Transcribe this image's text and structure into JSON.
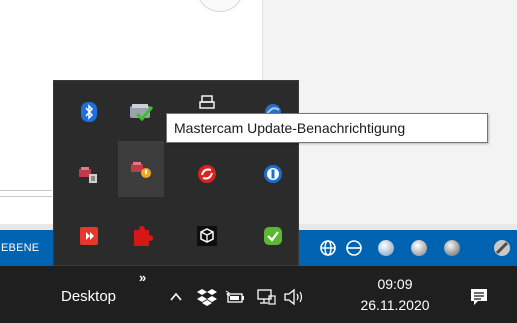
{
  "toolbar": {
    "label": "EBENE"
  },
  "taskbar": {
    "desktop_label": "Desktop",
    "overflow_chevron": "»",
    "clock": {
      "time": "09:09",
      "date": "26.11.2020"
    }
  },
  "tray_flyout": {
    "tooltip": "Mastercam Update-Benachrichtigung",
    "icons": [
      {
        "name": "bluetooth-icon"
      },
      {
        "name": "mastercam-check-icon"
      },
      {
        "name": "printer-icon"
      },
      {
        "name": "network-sync-icon"
      },
      {
        "name": "mastercam-license-icon"
      },
      {
        "name": "mastercam-update-icon"
      },
      {
        "name": "sync-circle-icon"
      },
      {
        "name": "password-manager-icon"
      },
      {
        "name": "anydesk-icon"
      },
      {
        "name": "puzzle-icon"
      },
      {
        "name": "cube-icon"
      },
      {
        "name": "shield-check-icon"
      }
    ]
  },
  "colors": {
    "taskbar": "#1f1f1f",
    "flyout": "#2b2b2b",
    "toolbar_blue": "#0063b1",
    "tooltip_bg": "#ffffff"
  }
}
